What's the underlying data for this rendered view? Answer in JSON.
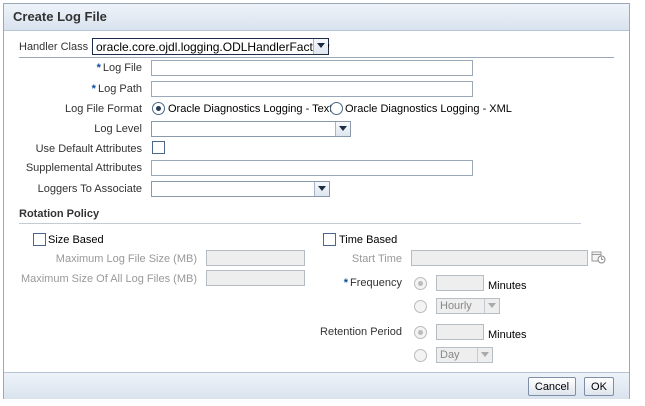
{
  "dialog": {
    "title": "Create Log File",
    "handler_class": {
      "label": "Handler Class",
      "value": "oracle.core.ojdl.logging.ODLHandlerFactory"
    },
    "log_file": {
      "required_mark": "*",
      "label": "Log File",
      "value": ""
    },
    "log_path": {
      "required_mark": "*",
      "label": "Log Path",
      "value": ""
    },
    "log_file_format": {
      "label": "Log File Format",
      "options": [
        {
          "label": "Oracle Diagnostics Logging - Text",
          "selected": true
        },
        {
          "label": "Oracle Diagnostics Logging - XML",
          "selected": false
        }
      ]
    },
    "log_level": {
      "label": "Log Level",
      "value": ""
    },
    "use_default_attributes": {
      "label": "Use Default Attributes",
      "checked": false
    },
    "supplemental_attributes": {
      "label": "Supplemental Attributes",
      "value": ""
    },
    "loggers_to_associate": {
      "label": "Loggers To Associate",
      "value": ""
    },
    "rotation_policy": {
      "heading": "Rotation Policy",
      "size_based": {
        "label": "Size Based",
        "checked": false,
        "max_log_file_size": {
          "label": "Maximum Log File Size (MB)",
          "value": ""
        },
        "max_size_all_files": {
          "label": "Maximum Size Of All Log Files (MB)",
          "value": ""
        }
      },
      "time_based": {
        "label": "Time Based",
        "checked": false,
        "start_time": {
          "label": "Start Time",
          "value": ""
        },
        "frequency": {
          "required_mark": "*",
          "label": "Frequency",
          "minutes_label": "Minutes",
          "minutes_value": "",
          "select_value": "Hourly"
        },
        "retention_period": {
          "label": "Retention Period",
          "minutes_label": "Minutes",
          "minutes_value": "",
          "select_value": "Day"
        }
      }
    },
    "buttons": {
      "cancel": "Cancel",
      "ok": "OK"
    }
  },
  "icons": {
    "calendar": "calendar-clock-icon",
    "dropdown": "chevron-down-icon"
  },
  "colors": {
    "title_bar": "#dce5ef",
    "required": "#0a4d9a",
    "border": "#9aa8b8"
  }
}
